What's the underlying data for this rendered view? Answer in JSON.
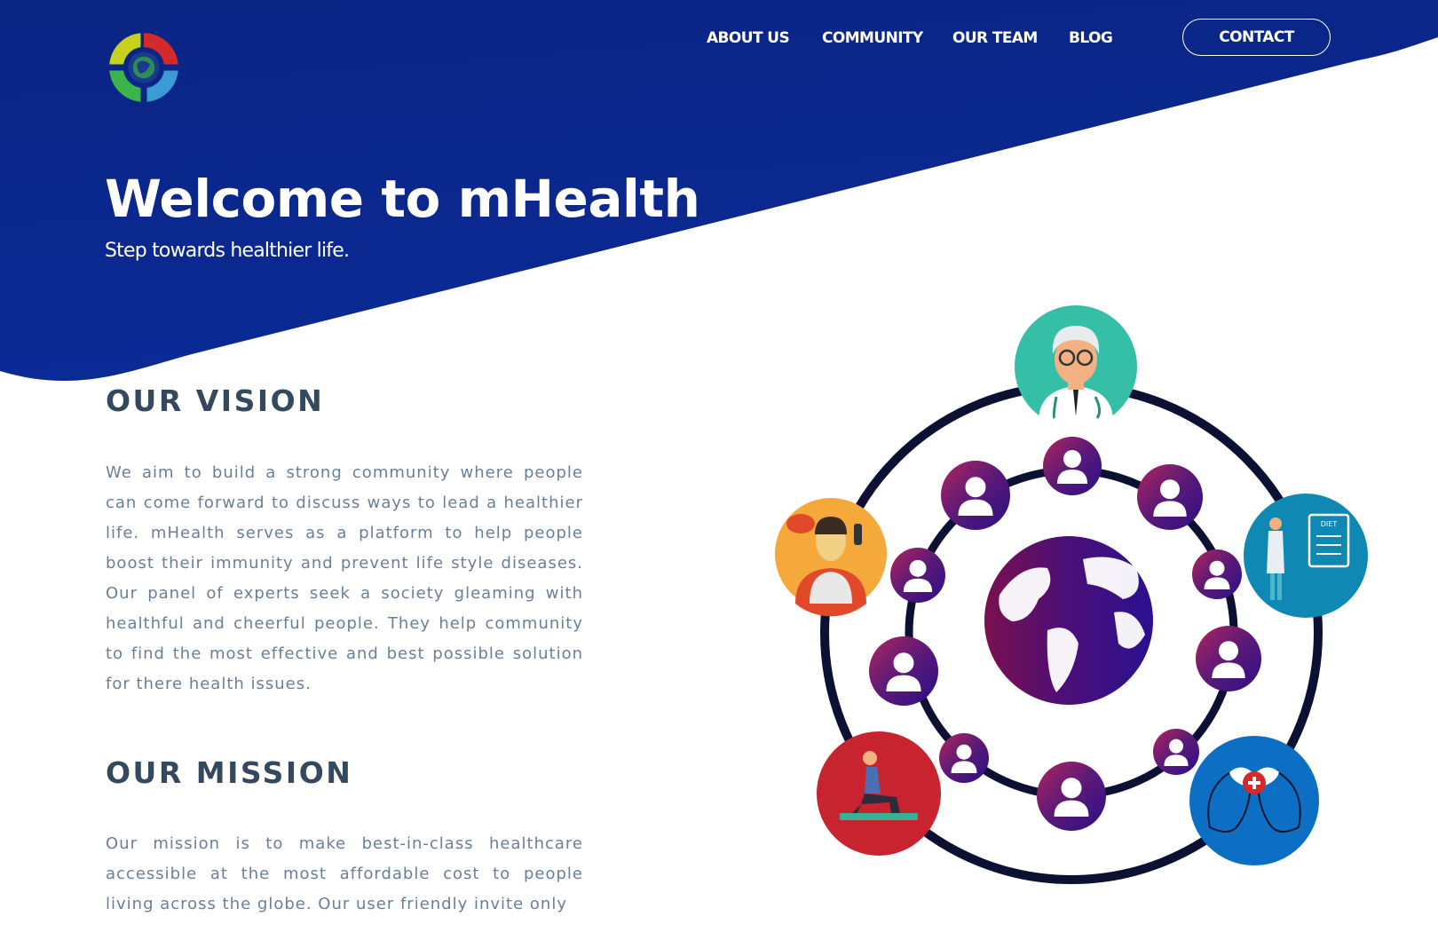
{
  "nav": {
    "about_label": "ABOUT US",
    "community_label": "COMMUNITY",
    "team_label": "OUR TEAM",
    "blog_label": "BLOG",
    "contact_label": "CONTACT"
  },
  "hero": {
    "title": "Welcome to mHealth",
    "subtitle": "Step towards healthier life."
  },
  "vision": {
    "heading": "OUR VISION",
    "text": "We aim to build a strong community where people can come forward to discuss ways to lead a healthier life. mHealth serves as a platform to help people boost their immunity and prevent life style diseases. Our panel of experts seek a society gleaming with healthful and cheerful people. They help community to find the most effective and best possible solution for there health issues."
  },
  "mission": {
    "heading": "OUR MISSION",
    "text": "Our mission is to make best-in-class healthcare accessible at the most affordable cost to people living across the globe. Our user friendly invite only"
  },
  "illustration": {
    "diet_label": "DIET"
  },
  "colors": {
    "hero_blue": "#0a2483",
    "heading": "#34485e",
    "body_text": "#6b7f96",
    "ring": "#0c1033"
  },
  "icons": {
    "logo": "mhealth-logo-icon",
    "globe": "globe-icon",
    "doctor": "doctor-icon",
    "dietitian": "dietitian-icon",
    "coach": "coach-icon",
    "yoga": "yoga-icon",
    "mental_health": "mental-health-icon",
    "community_member": "person-icon"
  }
}
